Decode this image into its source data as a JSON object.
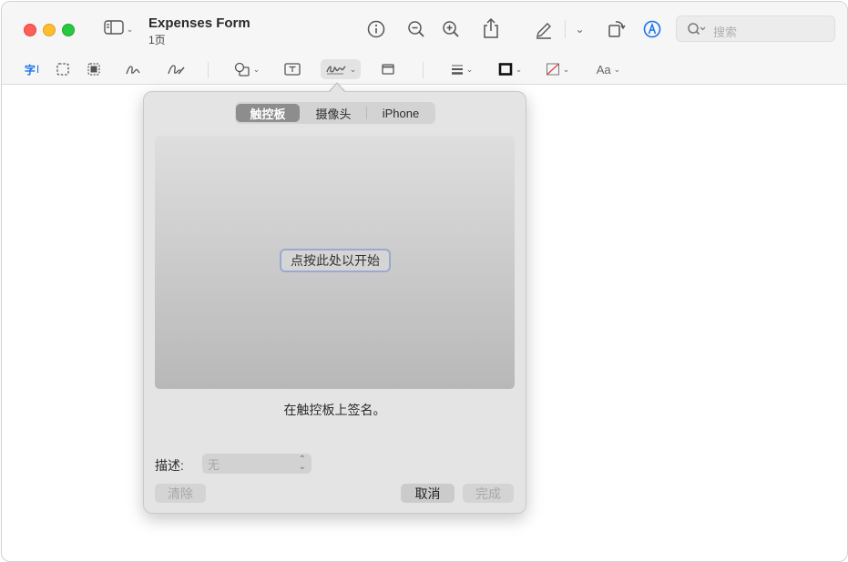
{
  "window": {
    "title": "Expenses Form",
    "subtitle": "1页"
  },
  "search": {
    "placeholder": "搜索"
  },
  "icons": {
    "sidebar": "sidebar-icon",
    "info": "info-icon",
    "zoom_out": "zoom-out-icon",
    "zoom_in": "zoom-in-icon",
    "share": "share-icon",
    "highlight": "highlight-pen-icon",
    "rotate": "rotate-icon",
    "markup": "markup-icon",
    "search": "search-icon"
  },
  "markup_toolbar": {
    "text_selection": "字",
    "font_label": "Aa"
  },
  "signature_popover": {
    "tabs": [
      "触控板",
      "摄像头",
      "iPhone"
    ],
    "selected_tab": "触控板",
    "start_button": "点按此处以开始",
    "caption": "在触控板上签名。",
    "description_label": "描述:",
    "description_value": "无",
    "clear_button": "清除",
    "cancel_button": "取消",
    "done_button": "完成"
  },
  "colors": {
    "accent": "#1a73e8",
    "close": "#ff5f57",
    "minimize": "#febc2e",
    "zoom": "#28c840"
  }
}
